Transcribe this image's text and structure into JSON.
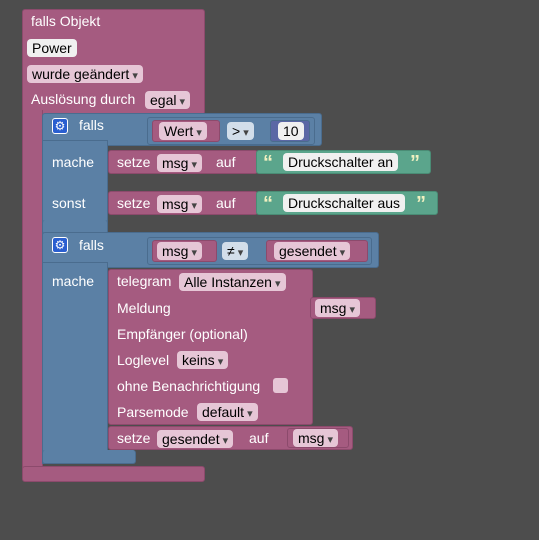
{
  "trigger": {
    "title": "falls Objekt",
    "object": "Power",
    "event": "wurde geändert",
    "trigger_by_label": "Auslösung durch",
    "trigger_by_value": "egal"
  },
  "if1": {
    "falls_label": "falls",
    "left_field": "Wert",
    "operator": ">",
    "right_value": "10",
    "mache_label": "mache",
    "sonst_label": "sonst",
    "then_set": {
      "label": "setze",
      "var": "msg",
      "auf": "auf",
      "text": "Druckschalter an"
    },
    "else_set": {
      "label": "setze",
      "var": "msg",
      "auf": "auf",
      "text": "Druckschalter aus"
    }
  },
  "if2": {
    "falls_label": "falls",
    "left_var": "msg",
    "operator": "≠",
    "right_var": "gesendet",
    "mache_label": "mache",
    "telegram": {
      "label": "telegram",
      "instance": "Alle Instanzen",
      "meldung_label": "Meldung",
      "meldung_var": "msg",
      "recipient_label": "Empfänger (optional)",
      "loglevel_label": "Loglevel",
      "loglevel_value": "keins",
      "no_notify_label": "ohne Benachrichtigung",
      "parsemode_label": "Parsemode",
      "parsemode_value": "default"
    },
    "set_after": {
      "label": "setze",
      "var": "gesendet",
      "auf": "auf",
      "value_var": "msg"
    }
  },
  "icons": {
    "gear": "gear-icon",
    "quote_open": "“",
    "quote_close": "”"
  },
  "colors": {
    "background": "#4d4d4d",
    "event_block": "#a55b80",
    "logic_block": "#5b80a5",
    "text_block": "#5ba58c"
  }
}
